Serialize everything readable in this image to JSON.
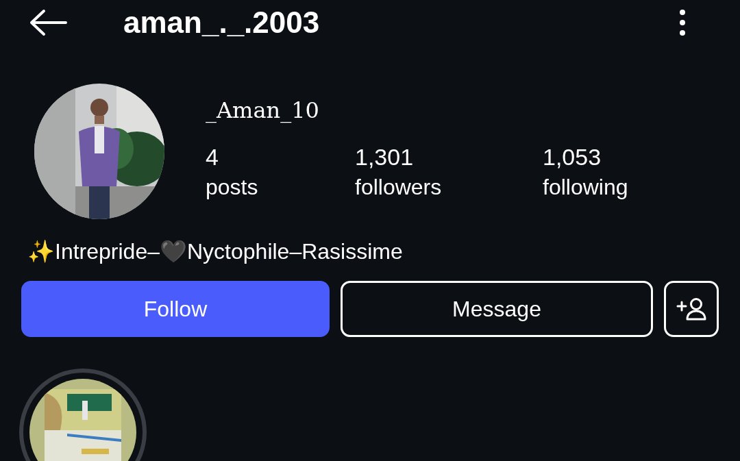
{
  "header": {
    "username": "aman_._.2003"
  },
  "profile": {
    "display_name": "_Aman_10",
    "stats": [
      {
        "value": "4",
        "label": "posts"
      },
      {
        "value": "1,301",
        "label": "followers"
      },
      {
        "value": "1,053",
        "label": "following"
      }
    ],
    "bio": "✨Intrepride–🖤Nyctophile–Rasissime"
  },
  "actions": [
    {
      "label": "Follow",
      "kind": "primary"
    },
    {
      "label": "Message",
      "kind": "outline"
    }
  ]
}
